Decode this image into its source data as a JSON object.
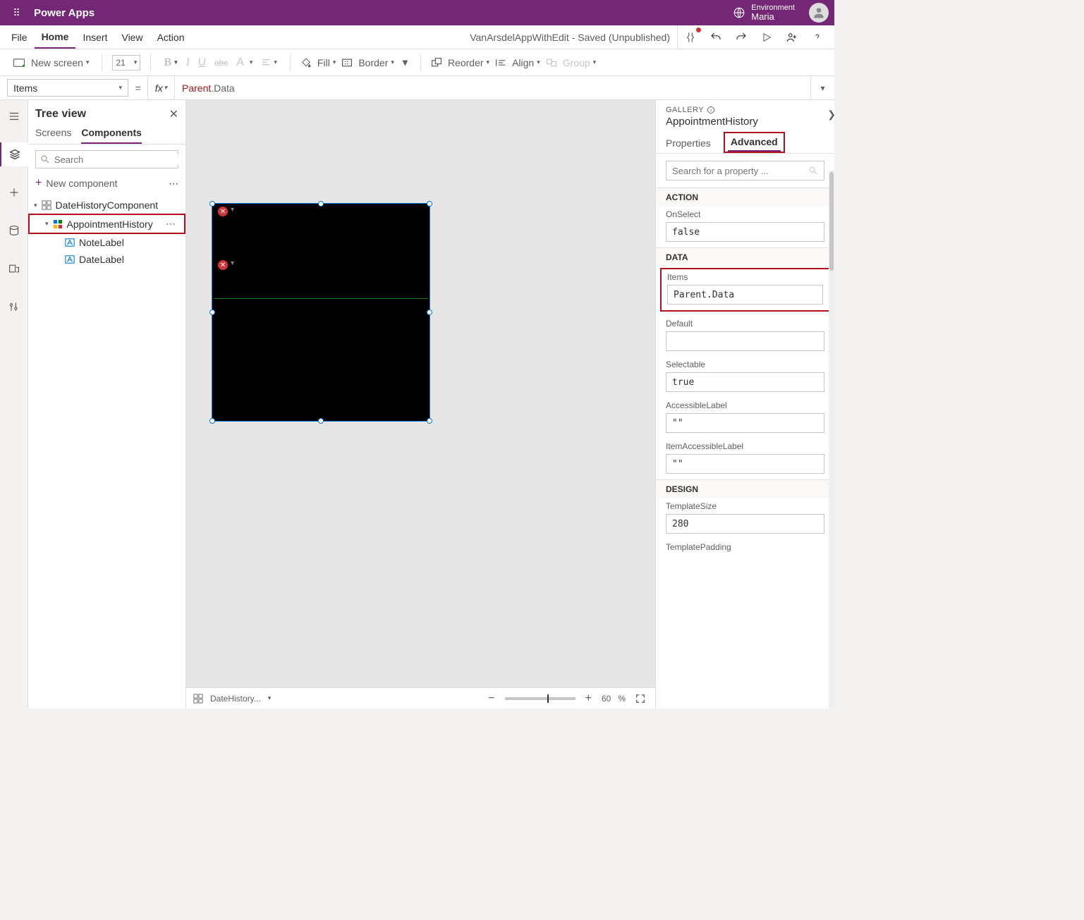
{
  "topbar": {
    "brand": "Power Apps",
    "env_label": "Environment",
    "env_name": "Maria"
  },
  "menu": {
    "file": "File",
    "home": "Home",
    "insert": "Insert",
    "view": "View",
    "action": "Action",
    "saved": "VanArsdelAppWithEdit - Saved (Unpublished)"
  },
  "ribbon": {
    "new_screen": "New screen",
    "font_size": "21",
    "fill": "Fill",
    "border": "Border",
    "reorder": "Reorder",
    "align": "Align",
    "group": "Group"
  },
  "formula": {
    "property": "Items",
    "eq": "=",
    "fx": "fx",
    "tok1": "Parent",
    "tok2": ".Data"
  },
  "tree": {
    "title": "Tree view",
    "tab_screens": "Screens",
    "tab_components": "Components",
    "search_placeholder": "Search",
    "new_component": "New component",
    "item_root": "DateHistoryComponent",
    "item_selected": "AppointmentHistory",
    "child1": "NoteLabel",
    "child2": "DateLabel"
  },
  "footer": {
    "crumb": "DateHistory...",
    "zoom_value": "60",
    "zoom_pct": "%"
  },
  "panel": {
    "type": "GALLERY",
    "name": "AppointmentHistory",
    "tab_props": "Properties",
    "tab_adv": "Advanced",
    "search_placeholder": "Search for a property ...",
    "section_action": "ACTION",
    "onselect_label": "OnSelect",
    "onselect_value": "false",
    "section_data": "DATA",
    "items_label": "Items",
    "items_value": "Parent.Data",
    "default_label": "Default",
    "default_value": "",
    "selectable_label": "Selectable",
    "selectable_value": "true",
    "accessible_label": "AccessibleLabel",
    "accessible_value": "\"\"",
    "itemaccessible_label": "ItemAccessibleLabel",
    "itemaccessible_value": "\"\"",
    "section_design": "DESIGN",
    "templatesize_label": "TemplateSize",
    "templatesize_value": "280",
    "templatepadding_label": "TemplatePadding"
  }
}
